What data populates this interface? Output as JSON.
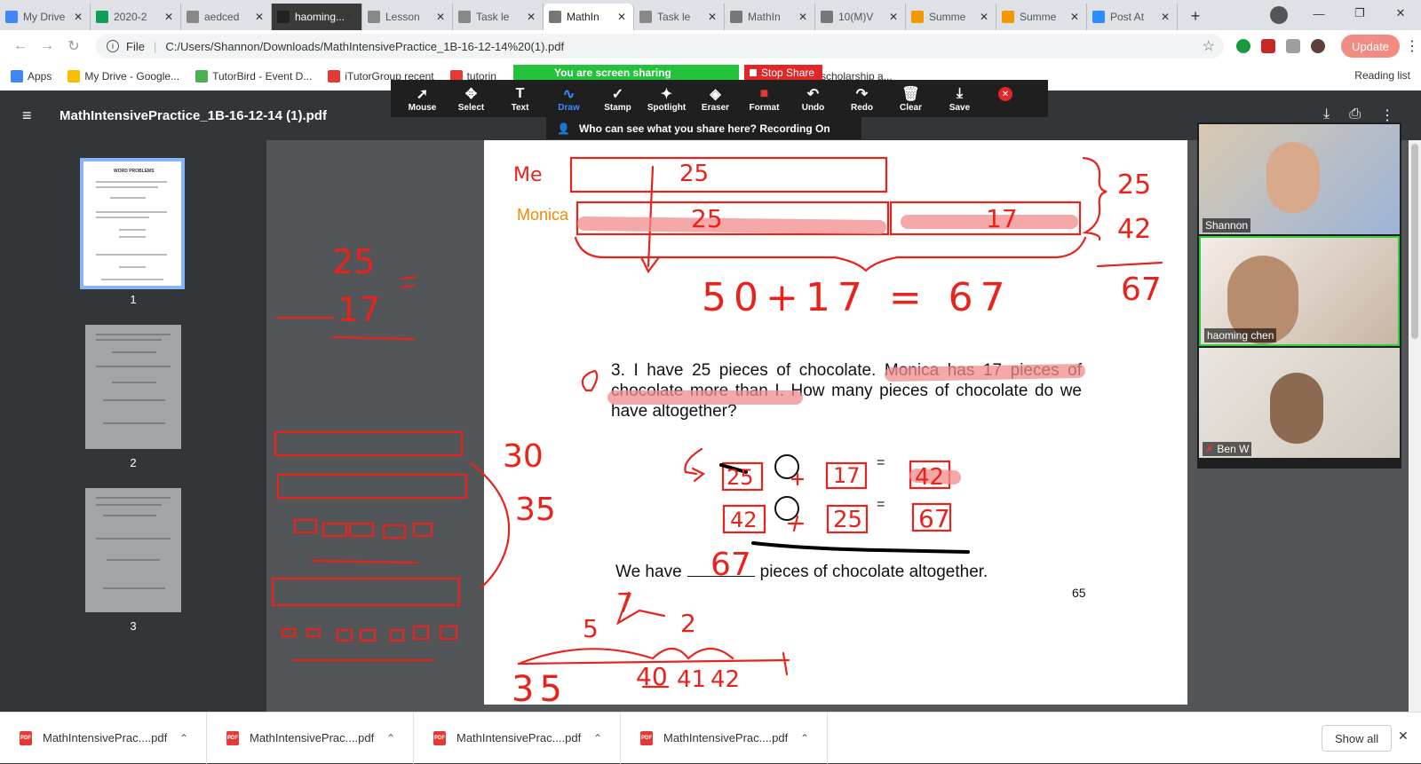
{
  "tabs": [
    {
      "title": "My Drive",
      "color": "#4285f4"
    },
    {
      "title": "2020-2",
      "color": "#0f9d58"
    },
    {
      "title": "aedced",
      "color": "#888888"
    },
    {
      "title": "haoming...",
      "color": "#222222"
    },
    {
      "title": "Lesson",
      "color": "#888888"
    },
    {
      "title": "Task le",
      "color": "#888888"
    },
    {
      "title": "MathIn",
      "color": "#777777"
    },
    {
      "title": "Task le",
      "color": "#888888"
    },
    {
      "title": "MathIn",
      "color": "#777777"
    },
    {
      "title": "10(M)V",
      "color": "#777777"
    },
    {
      "title": "Summe",
      "color": "#f29900"
    },
    {
      "title": "Summe",
      "color": "#f29900"
    },
    {
      "title": "Post At",
      "color": "#2d8cff"
    }
  ],
  "address": {
    "scheme": "File",
    "path": "C:/Users/Shannon/Downloads/MathIntensivePractice_1B-16-12-14%20(1).pdf"
  },
  "toolbar": {
    "update_label": "Update"
  },
  "bookmarks": [
    {
      "label": "Apps",
      "color": "#4285f4"
    },
    {
      "label": "My Drive - Google...",
      "color": "#fbbc04"
    },
    {
      "label": "TutorBird - Event D...",
      "color": "#4caf50"
    },
    {
      "label": "iTutorGroup recent",
      "color": "#e53935"
    },
    {
      "label": "tutorin",
      "color": "#e53935"
    }
  ],
  "bookmarks_tail": "scholarship a...",
  "reading_list": "Reading list",
  "zoom": {
    "sharing_text": "You are screen sharing",
    "stop_share": "Stop Share",
    "tools": [
      {
        "icon": "➚",
        "label": "Mouse"
      },
      {
        "icon": "✥",
        "label": "Select"
      },
      {
        "icon": "T",
        "label": "Text"
      },
      {
        "icon": "∿",
        "label": "Draw"
      },
      {
        "icon": "✓",
        "label": "Stamp"
      },
      {
        "icon": "✦",
        "label": "Spotlight"
      },
      {
        "icon": "◈",
        "label": "Eraser"
      },
      {
        "icon": "■",
        "label": "Format"
      },
      {
        "icon": "↶",
        "label": "Undo"
      },
      {
        "icon": "↷",
        "label": "Redo"
      },
      {
        "icon": "🗑",
        "label": "Clear"
      },
      {
        "icon": "⤓",
        "label": "Save"
      }
    ],
    "who_can_see": "Who can see what you share here? Recording On"
  },
  "pdf": {
    "title": "MathIntensivePractice_1B-16-12-14 (1).pdf",
    "pages": [
      "1",
      "2",
      "3"
    ],
    "thumb_heading": "WORD PROBLEMS",
    "monica_label": "Monica",
    "problem_number": "3.",
    "problem_text": "I have 25 pieces of chocolate. Monica has 17 pieces of chocolate more than I. How many pieces of chocolate do we have altogether?",
    "equals": "=",
    "answer_prefix": "We have",
    "answer_suffix": "pieces of chocolate altogether.",
    "page_number": "65"
  },
  "annotations": {
    "me": "Me",
    "bar_25": "25",
    "bar_17": "17",
    "sum_line": "50+17 = 67",
    "right_25": "25",
    "right_42": "42",
    "right_67": "67",
    "left_25": "25",
    "left_17": "17",
    "n30": "30",
    "n35": "35",
    "box1a": "25",
    "box1b": "17",
    "box1c": "42",
    "box2a": "42",
    "box2b": "25",
    "box2c": "67",
    "answer": "67",
    "five": "5",
    "seven": "7",
    "two": "2",
    "nl35": "35",
    "nl40": "40",
    "nl41": "41",
    "nl42": "42"
  },
  "participants": [
    {
      "name": "Shannon"
    },
    {
      "name": "haoming   chen"
    },
    {
      "name": "Ben W"
    }
  ],
  "downloads": [
    {
      "name": "MathIntensivePrac....pdf"
    },
    {
      "name": "MathIntensivePrac....pdf"
    },
    {
      "name": "MathIntensivePrac....pdf"
    },
    {
      "name": "MathIntensivePrac....pdf"
    }
  ],
  "show_all": "Show all",
  "colors": {
    "ink": "#e8231c",
    "highlight": "#f28b8b",
    "accent": "#8ab4f8"
  }
}
